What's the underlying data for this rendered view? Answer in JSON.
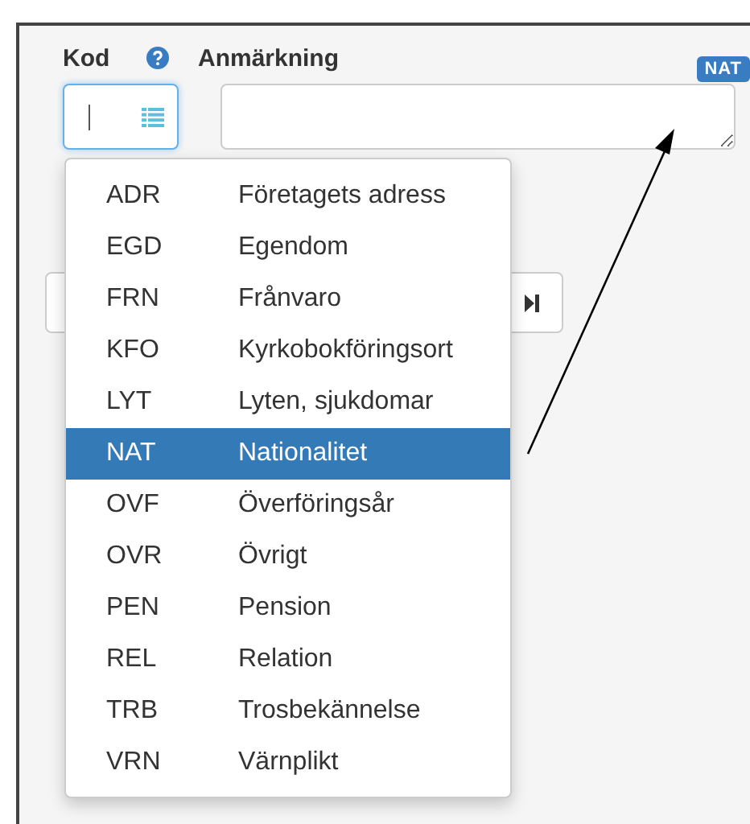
{
  "form": {
    "code_label": "Kod",
    "note_label": "Anmärkning",
    "badge": "NAT"
  },
  "dropdown": {
    "items": [
      {
        "code": "ADR",
        "label": "Företagets adress",
        "selected": false
      },
      {
        "code": "EGD",
        "label": "Egendom",
        "selected": false
      },
      {
        "code": "FRN",
        "label": "Frånvaro",
        "selected": false
      },
      {
        "code": "KFO",
        "label": "Kyrkobokföringsort",
        "selected": false
      },
      {
        "code": "LYT",
        "label": "Lyten, sjukdomar",
        "selected": false
      },
      {
        "code": "NAT",
        "label": "Nationalitet",
        "selected": true
      },
      {
        "code": "OVF",
        "label": "Överföringsår",
        "selected": false
      },
      {
        "code": "OVR",
        "label": "Övrigt",
        "selected": false
      },
      {
        "code": "PEN",
        "label": "Pension",
        "selected": false
      },
      {
        "code": "REL",
        "label": "Relation",
        "selected": false
      },
      {
        "code": "TRB",
        "label": "Trosbekännelse",
        "selected": false
      },
      {
        "code": "VRN",
        "label": "Värnplikt",
        "selected": false
      }
    ]
  }
}
